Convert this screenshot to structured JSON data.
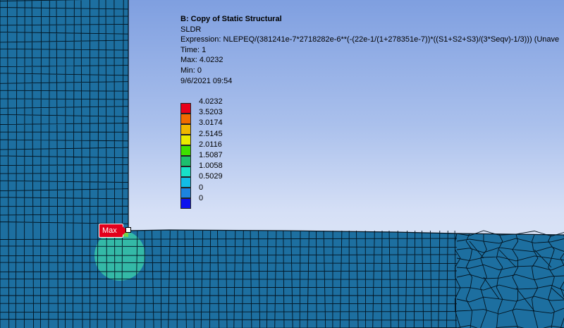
{
  "result": {
    "title": "B: Copy of Static Structural",
    "name": "SLDR",
    "expression": "Expression: NLEPEQ/(381241e-7*2718282e-6**(-(22e-1/(1+278351e-7))*((S1+S2+S3)/(3*Seqv)-1/3))) (Unave",
    "time": "Time: 1",
    "max": "Max: 4.0232",
    "min": "Min: 0",
    "date": "9/6/2021 09:54"
  },
  "legend": {
    "labels": [
      "4.0232",
      "3.5203",
      "3.0174",
      "2.5145",
      "2.0116",
      "1.5087",
      "1.0058",
      "0.5029",
      "0",
      "0"
    ],
    "colors": [
      "#e8001a",
      "#f06a00",
      "#f0b600",
      "#eaea00",
      "#3ee000",
      "#1dbf6e",
      "#18e0c8",
      "#12bce6",
      "#1c84e0",
      "#0c12ee"
    ]
  },
  "probe": {
    "label": "Max"
  },
  "colors": {
    "mesh_fill": "#1d6fa0",
    "mesh_line": "#02121e",
    "hotspot": "#39c9a8",
    "hotspot_core": "#76d64a"
  }
}
